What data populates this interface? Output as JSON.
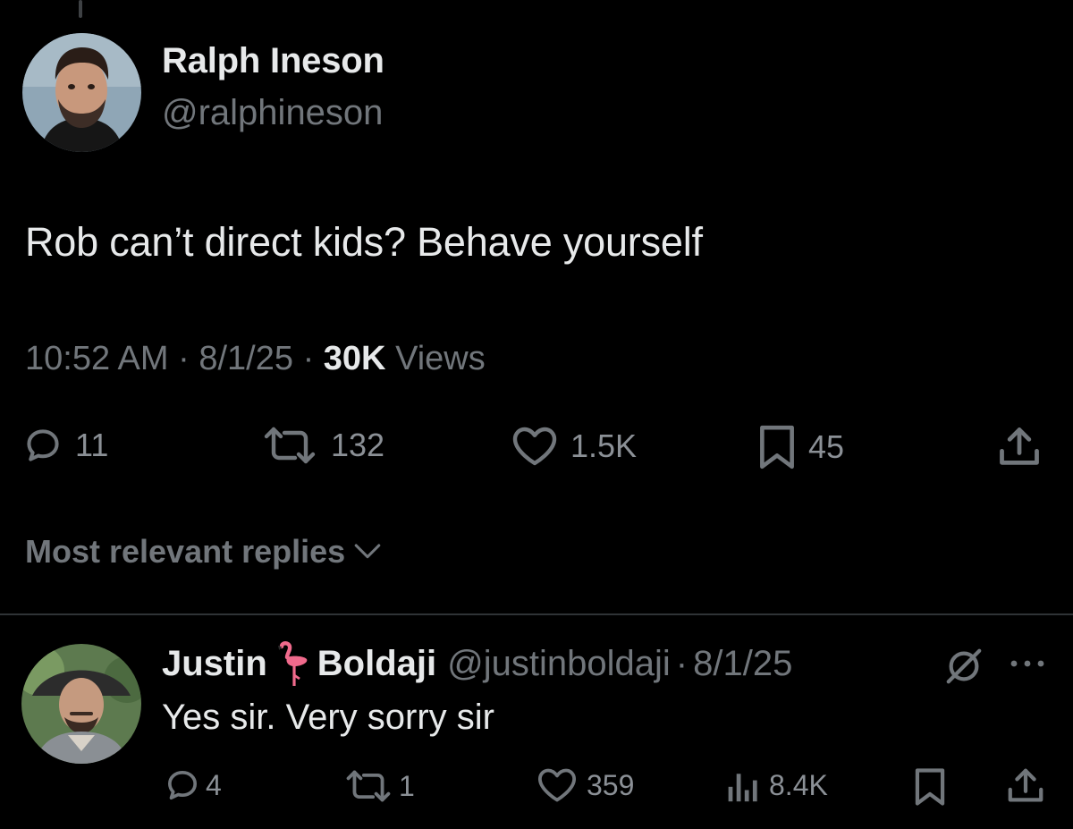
{
  "tweet": {
    "author_name": "Ralph Ineson",
    "author_handle": "@ralphineson",
    "text": "Rob can’t direct kids? Behave yourself",
    "time": "10:52 AM",
    "date": "8/1/25",
    "views_count": "30K",
    "views_label": "Views",
    "separator": "·",
    "actions": {
      "replies": "11",
      "reposts": "132",
      "likes": "1.5K",
      "bookmarks": "45"
    }
  },
  "replies_sort": {
    "label": "Most relevant replies"
  },
  "reply": {
    "name_first": "Justin",
    "name_emoji": "flamingo-emoji",
    "name_last": "Boldaji",
    "handle": "@justinboldaji",
    "separator": "·",
    "date": "8/1/25",
    "text": "Yes sir. Very sorry sir",
    "actions": {
      "replies": "4",
      "reposts": "1",
      "likes": "359",
      "views": "8.4K"
    }
  },
  "colors": {
    "background": "#000000",
    "primary_text": "#e7e9ea",
    "secondary_text": "#71767b",
    "divider": "#2f3336"
  }
}
